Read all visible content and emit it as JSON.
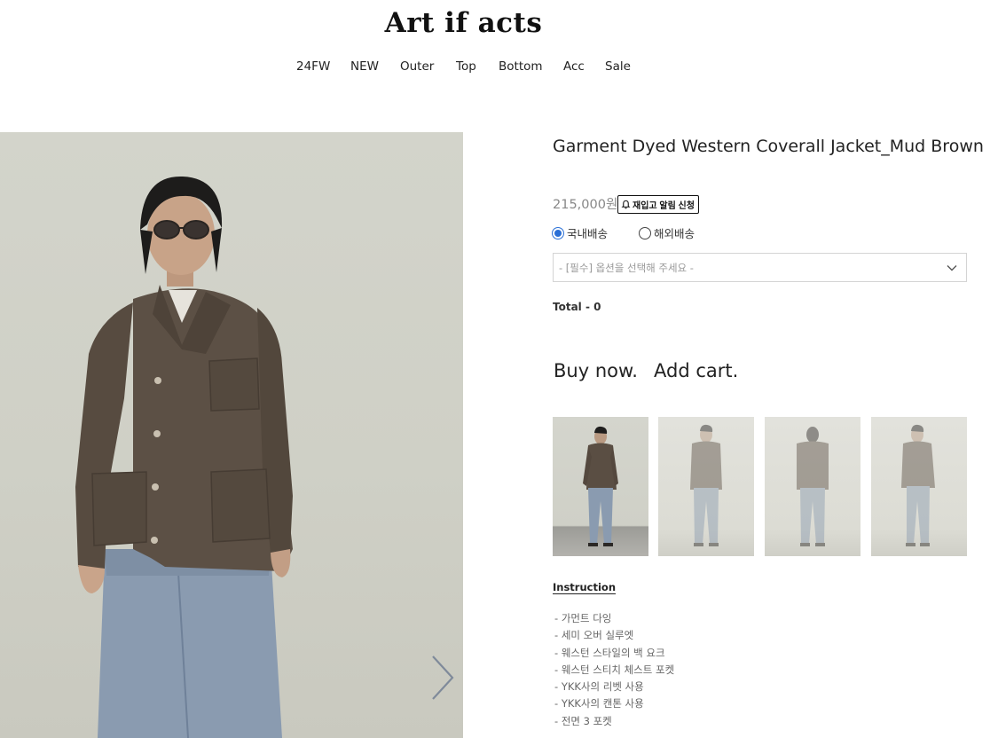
{
  "header": {
    "logo": "Art if acts",
    "nav": [
      "24FW",
      "NEW",
      "Outer",
      "Top",
      "Bottom",
      "Acc",
      "Sale"
    ]
  },
  "product": {
    "title": "Garment Dyed Western Coverall Jacket_Mud Brown",
    "price": "215,000원",
    "restock_label": "재입고 알림 신청",
    "shipping": {
      "domestic": "국내배송",
      "overseas": "해외배송",
      "selected": "domestic"
    },
    "option_placeholder": "- [필수] 옵션을 선택해 주세요 -",
    "total": "Total - 0",
    "buy_now": "Buy now.",
    "add_cart": "Add cart."
  },
  "instructions": {
    "title": "Instruction",
    "items": [
      "가먼트 다잉",
      "세미 오버 실루엣",
      "웨스턴 스타일의 백 요크",
      "웨스턴 스티치 체스트 포켓",
      "YKK사의 리벳 사용",
      "YKK사의 캔톤 사용",
      "전면 3 포켓"
    ]
  },
  "icons": {
    "next_arrow": "chevron-right-icon",
    "restock_bell": "bell-icon",
    "select_chevron": "chevron-down-icon"
  },
  "colors": {
    "radio_selected": "#2a6fd6",
    "jacket": "#5a4e42",
    "denim": "#8799ad"
  }
}
